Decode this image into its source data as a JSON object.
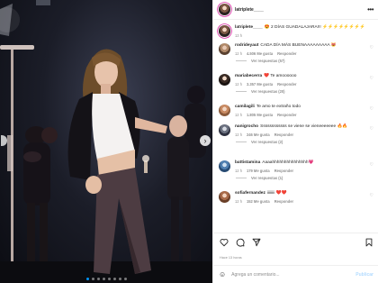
{
  "post": {
    "author": "latriplete____",
    "more_icon": "more-horizontal-icon"
  },
  "caption": {
    "user": "latriplete____",
    "text": "😍 2 DÍAS GUADALAJARA!!! ⚡️⚡️⚡️⚡️⚡️⚡️⚡️⚡️",
    "time": "13 h"
  },
  "comments": [
    {
      "user": "rodrideyaut",
      "text": "CADA DÍA MÁS BUENAAAAAAAAA 😻",
      "time": "12 h",
      "likes": "4.506 Me gusta",
      "reply": "Responder",
      "replies": "Ver respuestas (57)"
    },
    {
      "user": "mariabecerra",
      "text": "❤️ Te amoooooo",
      "time": "12 h",
      "likes": "3.357 Me gusta",
      "reply": "Responder",
      "replies": "Ver respuestas (20)"
    },
    {
      "user": "camilagili",
      "text": "Te amo te extraño todo",
      "time": "12 h",
      "likes": "1.805 Me gusta",
      "reply": "Responder",
      "replies": ""
    },
    {
      "user": "nanigrocho",
      "text": "Ssssssssssss se viene se vieneeeeeee 🔥🔥",
      "time": "12 h",
      "likes": "246 Me gusta",
      "reply": "Responder",
      "replies": "Ver respuestas (2)"
    },
    {
      "user": "battistamina",
      "text": "Aaaahhhhhhhhhhhhhhh💗",
      "time": "12 h",
      "likes": "179 Me gusta",
      "reply": "Responder",
      "replies": "Ver respuestas (1)"
    },
    {
      "user": "sofiafernandez",
      "text": "iiiiiiii ❤️❤️",
      "time": "12 h",
      "likes": "152 Me gusta",
      "reply": "Responder",
      "replies": ""
    }
  ],
  "actions": {
    "like": "heart-icon",
    "comment": "comment-icon",
    "share": "share-icon",
    "save": "bookmark-icon"
  },
  "timestamp": "Hace 13 horas",
  "add_comment": {
    "emoji_icon": "smiley-icon",
    "placeholder": "Agrega un comentario...",
    "publish": "Publicar"
  },
  "carousel": {
    "current": 1,
    "total": 8
  }
}
